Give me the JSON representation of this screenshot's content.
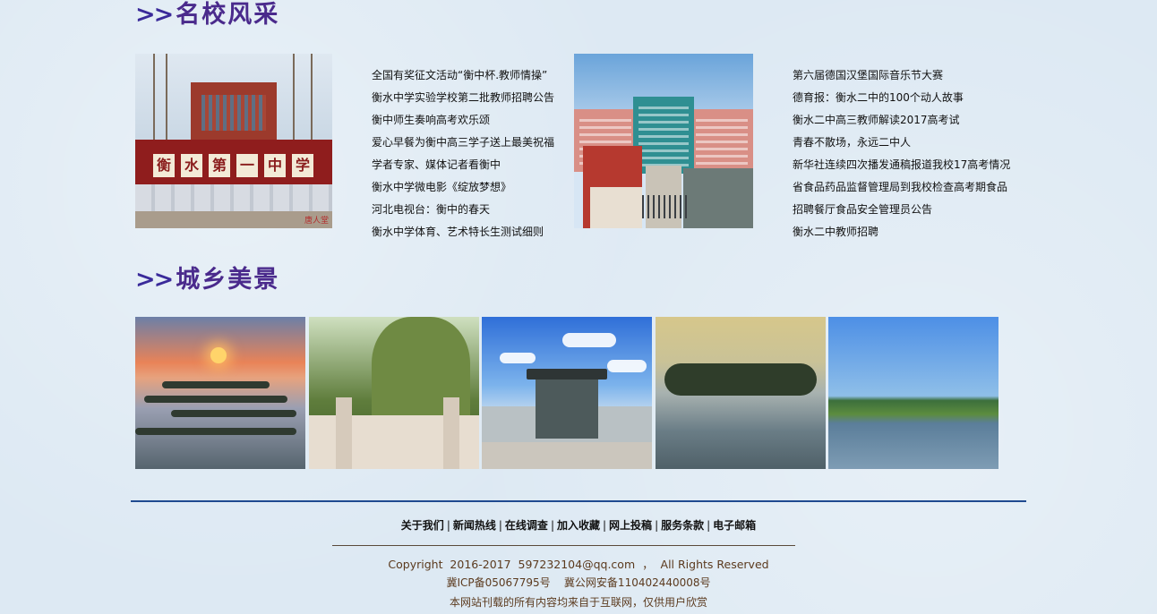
{
  "sections": {
    "school": {
      "arrows": ">>",
      "title": "名校风采"
    },
    "scenery": {
      "arrows": ">>",
      "title": "城乡美景"
    }
  },
  "school_photo_1": {
    "plaque": [
      "衡",
      "水",
      "第",
      "一",
      "中",
      "学"
    ],
    "watermark": "唐人堂"
  },
  "news_left": [
    "全国有奖征文活动“衡中杯.教师情操”",
    "衡水中学实验学校第二批教师招聘公告",
    "衡中师生奏响高考欢乐颂",
    "爱心早餐为衡中高三学子送上最美祝福",
    "学者专家、媒体记者看衡中",
    "衡水中学微电影《绽放梦想》",
    "河北电视台：衡中的春天",
    "衡水中学体育、艺术特长生测试细则"
  ],
  "news_right": [
    "第六届德国汉堡国际音乐节大赛",
    "德育报：衡水二中的100个动人故事",
    "衡水二中高三教师解读2017高考试",
    "青春不散场，永远二中人",
    "新华社连续四次播发通稿报道我校17高考情况",
    "省食品药品监督管理局到我校检查高考期食品",
    "招聘餐厅食品安全管理员公告",
    "衡水二中教师招聘"
  ],
  "footer": {
    "links": [
      "关于我们",
      "新闻热线",
      "在线调查",
      "加入收藏",
      "网上投稿",
      "服务条款",
      "电子邮箱"
    ],
    "separator": "|",
    "copyright": "Copyright  2016-2017  597232104@qq.com  ，  All Rights Reserved",
    "icp": "冀ICP备05067795号    冀公网安备110402440008号",
    "notice": "本网站刊载的所有内容均来自于互联网，仅供用户欣赏"
  },
  "colors": {
    "heading": "#4a2a8c",
    "footer_rule": "#1f4a90",
    "footer_text": "#5b3a1e",
    "page_bg": "#dde9f3"
  }
}
